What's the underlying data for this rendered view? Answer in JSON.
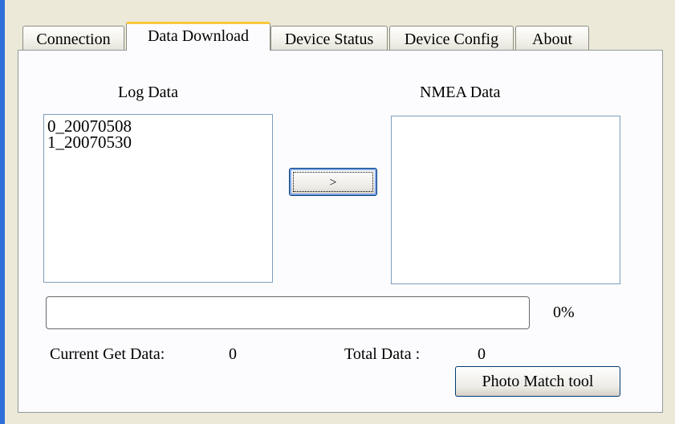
{
  "tabs": [
    {
      "label": "Connection",
      "active": false
    },
    {
      "label": "Data Download",
      "active": true
    },
    {
      "label": "Device Status",
      "active": false
    },
    {
      "label": "Device Config",
      "active": false
    },
    {
      "label": "About",
      "active": false
    }
  ],
  "log_data": {
    "title": "Log Data",
    "items": [
      "0_20070508",
      "1_20070530"
    ]
  },
  "transfer_button": {
    "label": ">"
  },
  "nmea_data": {
    "title": "NMEA Data",
    "items": []
  },
  "progress": {
    "value": 0,
    "text": "0%"
  },
  "status": {
    "current_label": "Current Get Data:",
    "current_value": "0",
    "total_label": "Total Data :",
    "total_value": "0"
  },
  "photo_match_button": {
    "label": "Photo Match tool"
  },
  "colors": {
    "frame_blue": "#2f6fd8",
    "active_tab_highlight": "#ffc83c",
    "window_bg": "#ece9d8",
    "progress_fill": "#2fb32f"
  }
}
